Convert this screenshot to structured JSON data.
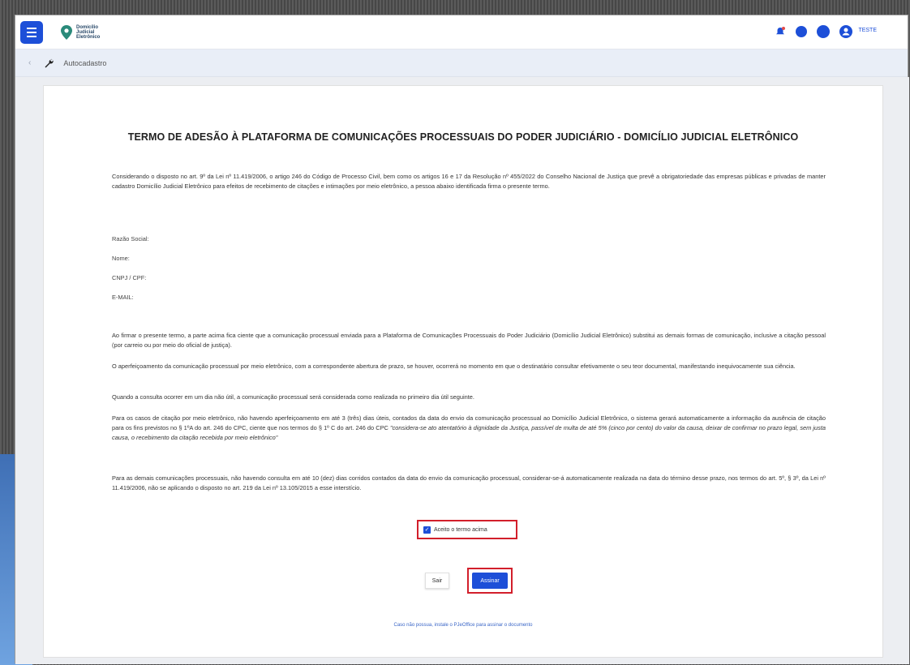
{
  "app": {
    "logo_text_1": "Domicílio",
    "logo_text_2": "Judicial",
    "logo_text_3": "Eletrônico",
    "user": "TESTE",
    "colors": {
      "primary": "#1d4fd8",
      "highlight": "#d21f2b"
    }
  },
  "breadcrumb": {
    "back": "‹",
    "page": "Autocadastro"
  },
  "document": {
    "title": "TERMO DE ADESÃO À PLATAFORMA DE COMUNICAÇÕES PROCESSUAIS DO PODER JUDICIÁRIO - DOMICÍLIO JUDICIAL ELETRÔNICO",
    "intro": "Considerando o disposto no art. 9º da Lei nº 11.419/2006, o artigo 246 do Código de Processo Civil, bem como os artigos 16 e 17 da Resolução nº 455/2022 do Conselho Nacional de Justiça que prevê a obrigatoriedade das empresas públicas e privadas de manter cadastro Domicílio Judicial Eletrônico para efeitos de recebimento de citações e intimações por meio eletrônico, a pessoa abaixo identificada firma o presente termo.",
    "fields": [
      "Razão Social:",
      "Nome:",
      "CNPJ / CPF:",
      "E-MAIL:"
    ],
    "p1": "Ao firmar o presente termo, a parte acima fica ciente que a comunicação processual enviada para a Plataforma de Comunicações Processuais do Poder Judiciário (Domicílio Judicial Eletrônico) substitui as demais formas de comunicação, inclusive a citação pessoal (por carreio ou por meio do oficial de justiça).",
    "p2": "O aperfeiçoamento da comunicação processual por meio eletrônico, com a correspondente abertura de prazo, se houver, ocorrerá no momento em que o destinatário consultar efetivamente o seu teor documental, manifestando inequivocamente sua ciência.",
    "p3": "Quando a consulta ocorrer em um dia não útil, a comunicação processual será considerada como realizada no primeiro dia útil seguinte.",
    "p4": "Para os casos de citação por meio eletrônico, não havendo aperfeiçoamento em até 3 (três) dias úteis, contados da data do envio da comunicação processual ao Domicílio Judicial Eletrônico, o sistema gerará automaticamente a informação da ausência de citação para os fins previstos no § 1ºA do art. 246 do CPC, ciente que nos termos do § 1º C do art. 246 do CPC",
    "p4_italic": "\"considera-se ato atentatório à dignidade da Justiça, passível de multa de até 5% (cinco por cento) do valor da causa, deixar de confirmar no prazo legal, sem justa causa, o recebimento da citação recebida por meio eletrônico\"",
    "p5": "Para as demais comunicações processuais, não havendo consulta em até 10 (dez) dias corridos contados da data do envio da comunicação processual, considerar-se-á automaticamente realizada na data do término desse prazo, nos termos do art. 5º, § 3º, da Lei nº 11.419/2006, não se aplicando o disposto no art. 219 da Lei nº 13.105/2015 a esse interstício."
  },
  "form": {
    "accept_label": "Aceito o termo acima",
    "accept_checked": true,
    "exit_label": "Sair",
    "sign_label": "Assinar",
    "help_link": "Caso não possua, instale o PJeOffice para assinar o documento"
  }
}
